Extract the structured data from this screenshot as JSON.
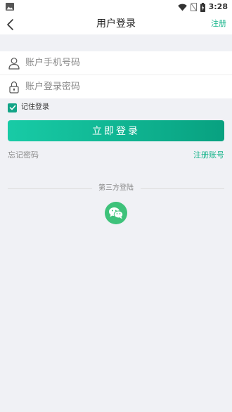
{
  "status_bar": {
    "time": "3:28",
    "icons": [
      "image-icon",
      "wifi-icon",
      "no-sim-icon",
      "battery-charging-icon"
    ]
  },
  "navbar": {
    "back_icon": "chevron-left-icon",
    "title": "用户登录",
    "register_label": "注册"
  },
  "form": {
    "phone": {
      "placeholder": "账户手机号码",
      "value": "",
      "icon": "user-icon"
    },
    "password": {
      "placeholder": "账户登录密码",
      "value": "",
      "icon": "lock-icon"
    }
  },
  "remember": {
    "label": "记住登录",
    "checked": true
  },
  "login_button": {
    "label": "立即登录"
  },
  "links": {
    "forgot_password": "忘记密码",
    "register_account": "注册账号"
  },
  "third_party": {
    "label": "第三方登陆",
    "providers": [
      "wechat-icon"
    ]
  },
  "colors": {
    "accent": "#19b58c",
    "button_gradient_start": "#18cba6",
    "button_gradient_end": "#08a180",
    "wechat": "#3ec27a",
    "background": "#f0f1f5"
  }
}
